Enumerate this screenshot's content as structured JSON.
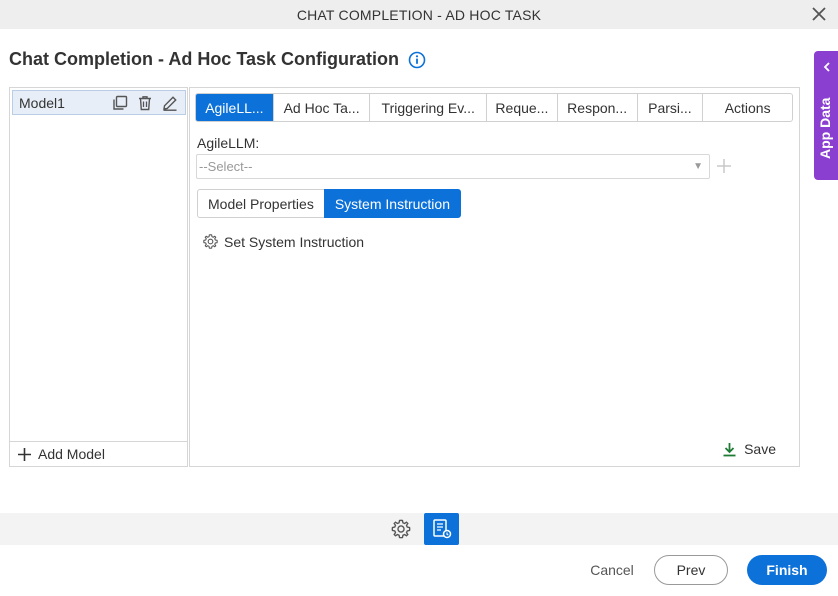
{
  "window": {
    "title": "CHAT COMPLETION - AD HOC TASK"
  },
  "heading": {
    "title": "Chat Completion - Ad Hoc Task Configuration"
  },
  "models": {
    "items": [
      {
        "label": "Model1"
      }
    ],
    "add_label": "Add Model"
  },
  "tabs": [
    {
      "label": "AgileLL...",
      "active": true
    },
    {
      "label": "Ad Hoc Ta...",
      "active": false
    },
    {
      "label": "Triggering Ev...",
      "active": false
    },
    {
      "label": "Reque...",
      "active": false
    },
    {
      "label": "Respon...",
      "active": false
    },
    {
      "label": "Parsi...",
      "active": false
    },
    {
      "label": "Actions",
      "active": false
    }
  ],
  "agilellm": {
    "label": "AgileLLM:",
    "select_value": "--Select--"
  },
  "subtabs": [
    {
      "label": "Model Properties",
      "active": false
    },
    {
      "label": "System Instruction",
      "active": true
    }
  ],
  "system_instruction": {
    "link_label": "Set System Instruction"
  },
  "save_label": "Save",
  "app_data": {
    "label": "App Data"
  },
  "footer": {
    "cancel_label": "Cancel",
    "prev_label": "Prev",
    "finish_label": "Finish"
  },
  "colors": {
    "accent": "#0c71d8",
    "app_data": "#8a3fd1",
    "save_icon": "#1e7b34"
  }
}
